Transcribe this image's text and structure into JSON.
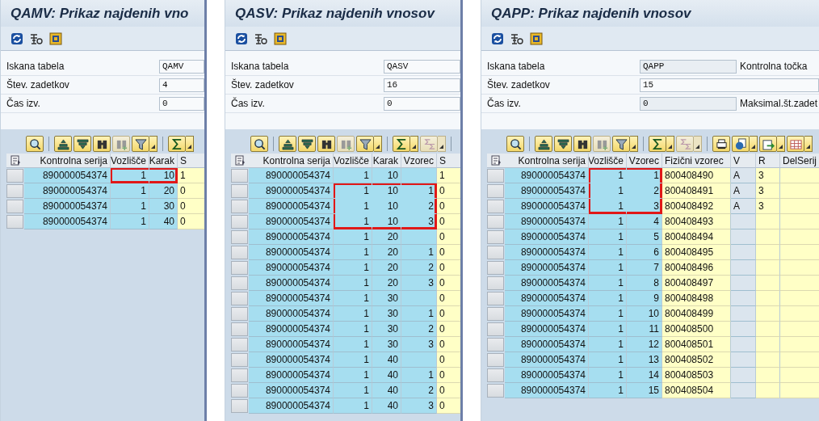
{
  "panels": [
    {
      "title": "QAMV: Prikaz najdenih vno",
      "toolbar": [
        {
          "kind": "refresh"
        },
        {
          "kind": "technical"
        },
        {
          "kind": "layout-box"
        }
      ],
      "fields": [
        {
          "label": "Iskana tabela",
          "value": "QAMV"
        },
        {
          "label": "Štev. zadetkov",
          "value": "4"
        },
        {
          "label": "Čas izv.",
          "value": "0"
        }
      ],
      "alv_toolbar": [
        {
          "kind": "details",
          "disabled": false,
          "dropdown": false
        },
        {
          "kind": "separator"
        },
        {
          "kind": "sort-asc",
          "disabled": false,
          "dropdown": false
        },
        {
          "kind": "sort-desc",
          "disabled": false,
          "dropdown": false
        },
        {
          "kind": "find",
          "disabled": false,
          "dropdown": false
        },
        {
          "kind": "find-next",
          "disabled": true,
          "dropdown": false
        },
        {
          "kind": "filter",
          "disabled": false,
          "dropdown": true
        },
        {
          "kind": "separator"
        },
        {
          "kind": "sum",
          "disabled": false,
          "dropdown": true
        }
      ],
      "columns": [
        {
          "label": "Kontrolna serija",
          "kind": "key"
        },
        {
          "label": "Vozlišče",
          "kind": "key"
        },
        {
          "label": "Karak",
          "kind": "key"
        },
        {
          "label": "S",
          "kind": "data"
        }
      ],
      "rows": [
        {
          "cells": [
            "890000054374",
            "1",
            "10",
            "1"
          ],
          "highlight": [
            false,
            true,
            true,
            false
          ]
        },
        {
          "cells": [
            "890000054374",
            "1",
            "20",
            "0"
          ],
          "highlight": [
            false,
            false,
            false,
            false
          ]
        },
        {
          "cells": [
            "890000054374",
            "1",
            "30",
            "0"
          ],
          "highlight": [
            false,
            false,
            false,
            false
          ]
        },
        {
          "cells": [
            "890000054374",
            "1",
            "40",
            "0"
          ],
          "highlight": [
            false,
            false,
            false,
            false
          ]
        }
      ]
    },
    {
      "title": "QASV: Prikaz najdenih vnosov",
      "toolbar": [
        {
          "kind": "refresh"
        },
        {
          "kind": "technical"
        },
        {
          "kind": "layout-box"
        }
      ],
      "fields": [
        {
          "label": "Iskana tabela",
          "value": "QASV"
        },
        {
          "label": "Štev. zadetkov",
          "value": "16"
        },
        {
          "label": "Čas izv.",
          "value": "0"
        }
      ],
      "alv_toolbar": [
        {
          "kind": "details",
          "disabled": false,
          "dropdown": false
        },
        {
          "kind": "separator"
        },
        {
          "kind": "sort-asc",
          "disabled": false,
          "dropdown": false
        },
        {
          "kind": "sort-desc",
          "disabled": false,
          "dropdown": false
        },
        {
          "kind": "find",
          "disabled": false,
          "dropdown": false
        },
        {
          "kind": "find-next",
          "disabled": true,
          "dropdown": false
        },
        {
          "kind": "filter",
          "disabled": false,
          "dropdown": true
        },
        {
          "kind": "separator"
        },
        {
          "kind": "sum",
          "disabled": false,
          "dropdown": true
        },
        {
          "kind": "subtotal",
          "disabled": true,
          "dropdown": true
        },
        {
          "kind": "separator"
        }
      ],
      "columns": [
        {
          "label": "Kontrolna serija",
          "kind": "key"
        },
        {
          "label": "Vozlišče",
          "kind": "key"
        },
        {
          "label": "Karak",
          "kind": "key"
        },
        {
          "label": "Vzorec",
          "kind": "key"
        },
        {
          "label": "S",
          "kind": "data"
        }
      ],
      "rows": [
        {
          "cells": [
            "890000054374",
            "1",
            "10",
            null,
            "1"
          ],
          "highlight": [
            false,
            false,
            false,
            false,
            false
          ]
        },
        {
          "cells": [
            "890000054374",
            "1",
            "10",
            "1",
            "0"
          ],
          "highlight": [
            false,
            true,
            true,
            true,
            false
          ]
        },
        {
          "cells": [
            "890000054374",
            "1",
            "10",
            "2",
            "0"
          ],
          "highlight": [
            false,
            true,
            true,
            true,
            false
          ]
        },
        {
          "cells": [
            "890000054374",
            "1",
            "10",
            "3",
            "0"
          ],
          "highlight": [
            false,
            true,
            true,
            true,
            false
          ]
        },
        {
          "cells": [
            "890000054374",
            "1",
            "20",
            null,
            "0"
          ],
          "highlight": [
            false,
            false,
            false,
            false,
            false
          ]
        },
        {
          "cells": [
            "890000054374",
            "1",
            "20",
            "1",
            "0"
          ],
          "highlight": [
            false,
            false,
            false,
            false,
            false
          ]
        },
        {
          "cells": [
            "890000054374",
            "1",
            "20",
            "2",
            "0"
          ],
          "highlight": [
            false,
            false,
            false,
            false,
            false
          ]
        },
        {
          "cells": [
            "890000054374",
            "1",
            "20",
            "3",
            "0"
          ],
          "highlight": [
            false,
            false,
            false,
            false,
            false
          ]
        },
        {
          "cells": [
            "890000054374",
            "1",
            "30",
            null,
            "0"
          ],
          "highlight": [
            false,
            false,
            false,
            false,
            false
          ]
        },
        {
          "cells": [
            "890000054374",
            "1",
            "30",
            "1",
            "0"
          ],
          "highlight": [
            false,
            false,
            false,
            false,
            false
          ]
        },
        {
          "cells": [
            "890000054374",
            "1",
            "30",
            "2",
            "0"
          ],
          "highlight": [
            false,
            false,
            false,
            false,
            false
          ]
        },
        {
          "cells": [
            "890000054374",
            "1",
            "30",
            "3",
            "0"
          ],
          "highlight": [
            false,
            false,
            false,
            false,
            false
          ]
        },
        {
          "cells": [
            "890000054374",
            "1",
            "40",
            null,
            "0"
          ],
          "highlight": [
            false,
            false,
            false,
            false,
            false
          ]
        },
        {
          "cells": [
            "890000054374",
            "1",
            "40",
            "1",
            "0"
          ],
          "highlight": [
            false,
            false,
            false,
            false,
            false
          ]
        },
        {
          "cells": [
            "890000054374",
            "1",
            "40",
            "2",
            "0"
          ],
          "highlight": [
            false,
            false,
            false,
            false,
            false
          ]
        },
        {
          "cells": [
            "890000054374",
            "1",
            "40",
            "3",
            "0"
          ],
          "highlight": [
            false,
            false,
            false,
            false,
            false
          ]
        }
      ]
    },
    {
      "title": "QAPP: Prikaz najdenih vnosov",
      "toolbar": [
        {
          "kind": "refresh"
        },
        {
          "kind": "technical"
        },
        {
          "kind": "layout-box"
        }
      ],
      "fields": [
        {
          "label": "Iskana tabela",
          "value": "QAPP",
          "side_label": "Kontrolna točka"
        },
        {
          "label": "Štev. zadetkov",
          "value": "15"
        },
        {
          "label": "Čas izv.",
          "value": "0",
          "side_label": "Maksimal.št.zadet"
        }
      ],
      "alv_toolbar": [
        {
          "kind": "details",
          "disabled": false,
          "dropdown": false
        },
        {
          "kind": "separator"
        },
        {
          "kind": "sort-asc",
          "disabled": false,
          "dropdown": false
        },
        {
          "kind": "sort-desc",
          "disabled": false,
          "dropdown": false
        },
        {
          "kind": "find",
          "disabled": false,
          "dropdown": false
        },
        {
          "kind": "find-next",
          "disabled": true,
          "dropdown": false
        },
        {
          "kind": "filter",
          "disabled": false,
          "dropdown": true
        },
        {
          "kind": "separator"
        },
        {
          "kind": "sum",
          "disabled": false,
          "dropdown": true
        },
        {
          "kind": "subtotal",
          "disabled": true,
          "dropdown": true
        },
        {
          "kind": "separator"
        },
        {
          "kind": "print",
          "disabled": false,
          "dropdown": false
        },
        {
          "kind": "view",
          "disabled": false,
          "dropdown": true
        },
        {
          "kind": "export",
          "disabled": false,
          "dropdown": true
        },
        {
          "kind": "layout",
          "disabled": false,
          "dropdown": true
        }
      ],
      "columns": [
        {
          "label": "Kontrolna serija",
          "kind": "key"
        },
        {
          "label": "Vozlišče",
          "kind": "key"
        },
        {
          "label": "Vzorec",
          "kind": "key"
        },
        {
          "label": "Fizični vzorec",
          "kind": "data"
        },
        {
          "label": "V",
          "kind": "neutral"
        },
        {
          "label": "R",
          "kind": "data"
        },
        {
          "label": "DelSerij",
          "kind": "data"
        }
      ],
      "rows": [
        {
          "cells": [
            "890000054374",
            "1",
            "1",
            "800408490",
            "A",
            "3",
            null
          ],
          "highlight": [
            false,
            true,
            true,
            false,
            false,
            false,
            false
          ]
        },
        {
          "cells": [
            "890000054374",
            "1",
            "2",
            "800408491",
            "A",
            "3",
            null
          ],
          "highlight": [
            false,
            true,
            true,
            false,
            false,
            false,
            false
          ]
        },
        {
          "cells": [
            "890000054374",
            "1",
            "3",
            "800408492",
            "A",
            "3",
            null
          ],
          "highlight": [
            false,
            true,
            true,
            false,
            false,
            false,
            false
          ]
        },
        {
          "cells": [
            "890000054374",
            "1",
            "4",
            "800408493",
            null,
            null,
            null
          ],
          "highlight": [
            false,
            false,
            false,
            false,
            false,
            false,
            false
          ]
        },
        {
          "cells": [
            "890000054374",
            "1",
            "5",
            "800408494",
            null,
            null,
            null
          ],
          "highlight": [
            false,
            false,
            false,
            false,
            false,
            false,
            false
          ]
        },
        {
          "cells": [
            "890000054374",
            "1",
            "6",
            "800408495",
            null,
            null,
            null
          ],
          "highlight": [
            false,
            false,
            false,
            false,
            false,
            false,
            false
          ]
        },
        {
          "cells": [
            "890000054374",
            "1",
            "7",
            "800408496",
            null,
            null,
            null
          ],
          "highlight": [
            false,
            false,
            false,
            false,
            false,
            false,
            false
          ]
        },
        {
          "cells": [
            "890000054374",
            "1",
            "8",
            "800408497",
            null,
            null,
            null
          ],
          "highlight": [
            false,
            false,
            false,
            false,
            false,
            false,
            false
          ]
        },
        {
          "cells": [
            "890000054374",
            "1",
            "9",
            "800408498",
            null,
            null,
            null
          ],
          "highlight": [
            false,
            false,
            false,
            false,
            false,
            false,
            false
          ]
        },
        {
          "cells": [
            "890000054374",
            "1",
            "10",
            "800408499",
            null,
            null,
            null
          ],
          "highlight": [
            false,
            false,
            false,
            false,
            false,
            false,
            false
          ]
        },
        {
          "cells": [
            "890000054374",
            "1",
            "11",
            "800408500",
            null,
            null,
            null
          ],
          "highlight": [
            false,
            false,
            false,
            false,
            false,
            false,
            false
          ]
        },
        {
          "cells": [
            "890000054374",
            "1",
            "12",
            "800408501",
            null,
            null,
            null
          ],
          "highlight": [
            false,
            false,
            false,
            false,
            false,
            false,
            false
          ]
        },
        {
          "cells": [
            "890000054374",
            "1",
            "13",
            "800408502",
            null,
            null,
            null
          ],
          "highlight": [
            false,
            false,
            false,
            false,
            false,
            false,
            false
          ]
        },
        {
          "cells": [
            "890000054374",
            "1",
            "14",
            "800408503",
            null,
            null,
            null
          ],
          "highlight": [
            false,
            false,
            false,
            false,
            false,
            false,
            false
          ]
        },
        {
          "cells": [
            "890000054374",
            "1",
            "15",
            "800408504",
            null,
            null,
            null
          ],
          "highlight": [
            false,
            false,
            false,
            false,
            false,
            false,
            false
          ]
        }
      ]
    }
  ]
}
